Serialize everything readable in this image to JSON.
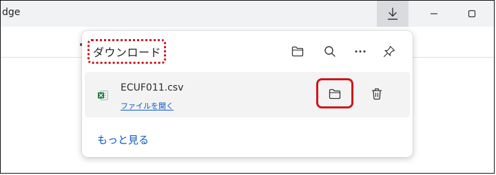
{
  "window": {
    "title_fragment": "dge"
  },
  "download_panel": {
    "title": "ダウンロード",
    "header_icons": [
      "folder-icon",
      "search-icon",
      "more-icon",
      "pin-icon"
    ],
    "items": [
      {
        "file_name": "ECUF011.csv",
        "action_label": "ファイルを開く",
        "file_type_icon": "excel-csv-icon",
        "buttons": [
          "folder-icon",
          "trash-icon"
        ]
      }
    ],
    "more_label": "もっと見る"
  },
  "colors": {
    "highlight": "#d0141b",
    "link": "#0b57c9",
    "excel_green": "#1d7a45"
  }
}
